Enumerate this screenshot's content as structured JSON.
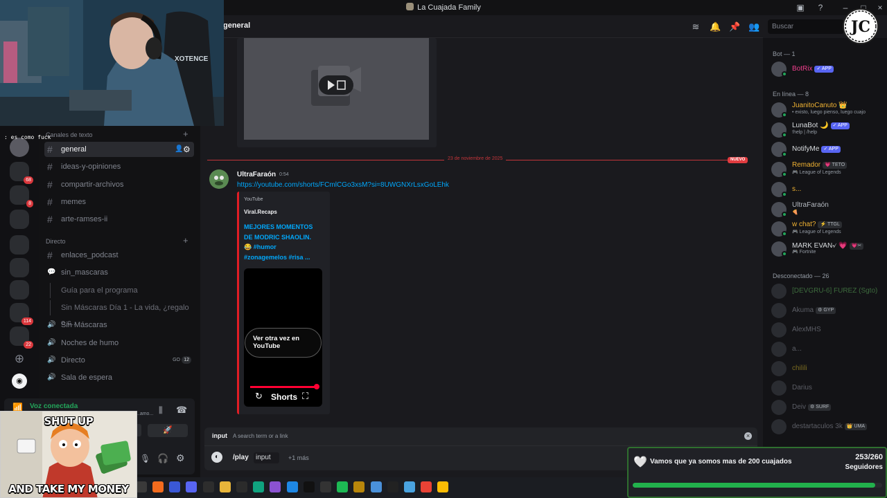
{
  "window": {
    "title": "La Cuajada Family"
  },
  "header": {
    "channel": "general",
    "search_placeholder": "Buscar"
  },
  "overlay": {
    "streamer_logo": "JC",
    "chat_user": "",
    "chat_message": "es como fuck",
    "webcam_chair_text": "XOTENCE"
  },
  "servers": [
    {
      "badge": "68",
      "icon": "server-icon"
    },
    {
      "badge": "8",
      "icon": "server-icon"
    },
    {
      "badge": "",
      "icon": "server-icon"
    },
    {
      "badge": "",
      "icon": "server-icon"
    },
    {
      "badge": "",
      "icon": "server-icon"
    },
    {
      "badge": "",
      "icon": "server-icon"
    },
    {
      "badge": "114",
      "icon": "server-icon"
    },
    {
      "badge": "22",
      "icon": "server-icon"
    }
  ],
  "sidebar": {
    "category_text": "Canales de texto",
    "channels": [
      {
        "name": "general",
        "type": "text",
        "active": true
      },
      {
        "name": "ideas-y-opiniones",
        "type": "text"
      },
      {
        "name": "compartir-archivos",
        "type": "text"
      },
      {
        "name": "memes",
        "type": "text"
      },
      {
        "name": "arte-ramses-ii",
        "type": "text"
      }
    ],
    "category_direct": "Directo",
    "channels2": [
      {
        "name": "enlaces_podcast",
        "type": "text"
      },
      {
        "name": "sin_mascaras",
        "type": "forum"
      },
      {
        "name": "Guía para el programa",
        "type": "thread"
      },
      {
        "name": "Sin Máscaras Día 1 - La vida, ¿regalo o c...",
        "type": "thread"
      },
      {
        "name": "Sin Máscaras",
        "type": "voice"
      },
      {
        "name": "Noches de humo",
        "type": "voice"
      },
      {
        "name": "Directo",
        "type": "voice",
        "tag": "GO",
        "count": "12"
      },
      {
        "name": "Sala de espera",
        "type": "voice"
      }
    ],
    "voice_status": "Voz conectada",
    "voice_sub": "...amo..."
  },
  "chat": {
    "date_divider": "23 de noviembre de 2025",
    "new_badge": "NUEVO",
    "message": {
      "author": "UltraFaraón",
      "time": "0:54",
      "link": "https://youtube.com/shorts/FCmlCGo3xsM?si=8UWGNXrLsxGoLEhk"
    },
    "embed": {
      "provider": "YouTube",
      "author": "Viral.Recaps",
      "title_line1": "MEJORES MOMENTOS",
      "title_line2": "DE MODRIC SHAOLIN.",
      "title_line3": "😂 #humor",
      "title_line4": "#zonagemelos #risa ...",
      "replay_label": "Ver otra vez en YouTube",
      "shorts_label": "Shorts",
      "progress": 1.0
    }
  },
  "input": {
    "param_name": "input",
    "param_hint": "A search term or a link",
    "command": "/play",
    "chip": "input",
    "more": "+1 más"
  },
  "members": {
    "bot_header": "Bot — 1",
    "bots": [
      {
        "name": "BotRix",
        "tag": "✓ APP",
        "color": "#f23f8e"
      }
    ],
    "online_header": "En línea — 8",
    "online": [
      {
        "name": "JuanitoCanuto 👑",
        "status": "• existo, luego pienso, luego cuajo",
        "color": "#f0b232"
      },
      {
        "name": "LunaBot 🌙",
        "tag": "✓ APP",
        "status": "!help | /help",
        "color": "#dbdee1"
      },
      {
        "name": "NotifyMe",
        "tag": "✓ APP",
        "status": "",
        "color": "#dbdee1"
      },
      {
        "name": "Remador",
        "tag2": "💗 TETO",
        "status": "🎮 League of Legends",
        "color": "#f0b232"
      },
      {
        "name": "s...",
        "status": "",
        "color": "#f0b232"
      },
      {
        "name": "UltraFaraón",
        "status": "🍕",
        "color": "#b5bac1"
      },
      {
        "name": "w chat?",
        "tag2": "⚡ TTGL",
        "status": "🎮 League of Legends",
        "color": "#f0b232"
      },
      {
        "name": "MARK EVAN৵ 💗",
        "tag2": "💗✂",
        "status": "🎮 Fortnite",
        "color": "#dbdee1"
      }
    ],
    "offline_header": "Desconectado — 26",
    "offline": [
      {
        "name": "[DEVGRU-6] FUREZ (Sgto)",
        "color": "#3d6b3d"
      },
      {
        "name": "Akuma",
        "tag2": "⚙ GYP"
      },
      {
        "name": "AlexMHS"
      },
      {
        "name": "a..."
      },
      {
        "name": "chilili",
        "color": "#7a6a20"
      },
      {
        "name": "Darius"
      },
      {
        "name": "Deiv",
        "tag2": "⚙ SURF"
      },
      {
        "name": "destartaculos 3k",
        "tag2": "👑 UMA"
      }
    ]
  },
  "alert": {
    "message": "Vamos que ya somos mas de 200 cuajados",
    "count": "253/260",
    "label": "Seguidores",
    "progress": 0.973
  },
  "meme": {
    "top": "SHUT UP",
    "bottom": "AND TAKE MY MONEY"
  },
  "taskbar": {
    "icons": [
      {
        "icon": "brave-icon",
        "color": "#f26b1d"
      },
      {
        "icon": "vivaldi-icon",
        "color": "#3a58d6"
      },
      {
        "icon": "discord-icon",
        "color": "#5865f2"
      },
      {
        "icon": "xbox-icon",
        "color": "#2d2d2d"
      },
      {
        "icon": "folder-icon",
        "color": "#e8b53a"
      },
      {
        "icon": "obs-icon",
        "color": "#2b2b2b"
      },
      {
        "icon": "chatgpt-icon",
        "color": "#10a37f"
      },
      {
        "icon": "visual-studio-icon",
        "color": "#8b52d1"
      },
      {
        "icon": "vscode-icon",
        "color": "#1e88e5"
      },
      {
        "icon": "capcut-icon",
        "color": "#111"
      },
      {
        "icon": "unity-icon",
        "color": "#333"
      },
      {
        "icon": "spotify-icon",
        "color": "#1db954"
      },
      {
        "icon": "lol-icon",
        "color": "#b8860b"
      },
      {
        "icon": "pen-icon",
        "color": "#4a90d9"
      },
      {
        "icon": "terminal-icon",
        "color": "#222"
      },
      {
        "icon": "notepad-icon",
        "color": "#4aa3df"
      },
      {
        "icon": "chrome-icon",
        "color": "#e94235"
      },
      {
        "icon": "chrome-alt-icon",
        "color": "#fbbc04"
      }
    ]
  }
}
